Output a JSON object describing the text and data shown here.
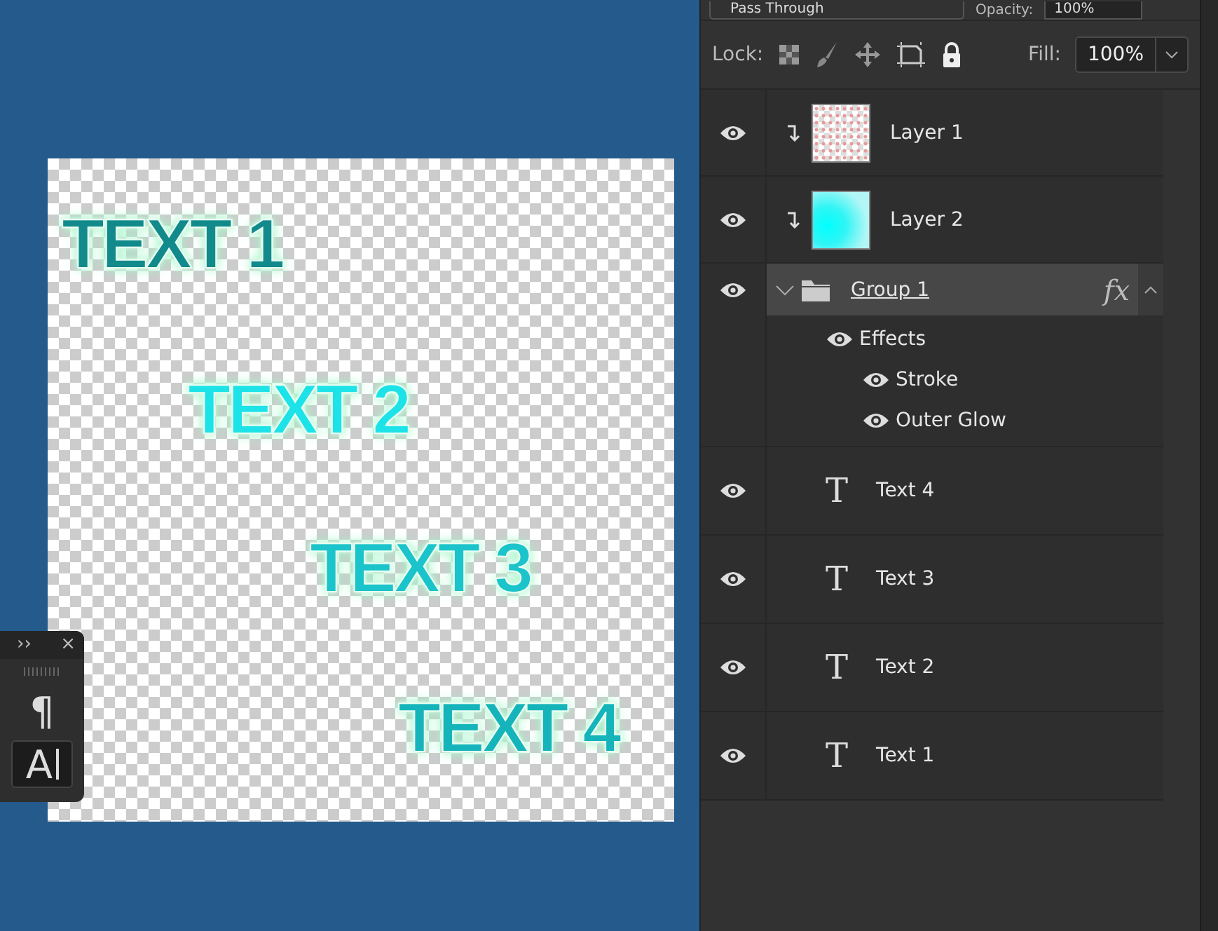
{
  "canvas": {
    "texts": [
      {
        "text": "TEXT 1",
        "color": "#128a8c"
      },
      {
        "text": "TEXT 2",
        "color": "#1de3e8"
      },
      {
        "text": "TEXT 3",
        "color": "#1ac4ca"
      },
      {
        "text": "TEXT 4",
        "color": "#14b4ba"
      }
    ]
  },
  "tool_panel": {
    "collapse": "››",
    "close": "×",
    "buttons": [
      {
        "glyph": "¶",
        "selected": false
      },
      {
        "glyph": "A",
        "selected": true
      }
    ]
  },
  "layers_panel": {
    "blend_mode": "Pass Through",
    "opacity": {
      "label": "Opacity:",
      "value": "100%"
    },
    "lock": {
      "label": "Lock:"
    },
    "fill": {
      "label": "Fill:",
      "value": "100%"
    },
    "layers": [
      {
        "kind": "pixel",
        "name": "Layer 1",
        "visible": true,
        "clipped": true,
        "selected": false
      },
      {
        "kind": "pixel",
        "name": "Layer 2",
        "visible": true,
        "clipped": true,
        "selected": false
      },
      {
        "kind": "group",
        "name": "Group 1",
        "visible": true,
        "selected": true,
        "expanded": true,
        "fx": "fx",
        "effects": [
          {
            "name": "Effects",
            "visible": true,
            "children": [
              {
                "name": "Stroke",
                "visible": true
              },
              {
                "name": "Outer Glow",
                "visible": true
              }
            ]
          }
        ]
      },
      {
        "kind": "text",
        "glyph": "T",
        "name": "Text 4",
        "visible": true,
        "selected": false
      },
      {
        "kind": "text",
        "glyph": "T",
        "name": "Text 3",
        "visible": true,
        "selected": false
      },
      {
        "kind": "text",
        "glyph": "T",
        "name": "Text 2",
        "visible": true,
        "selected": false
      },
      {
        "kind": "text",
        "glyph": "T",
        "name": "Text 1",
        "visible": true,
        "selected": false
      }
    ]
  }
}
